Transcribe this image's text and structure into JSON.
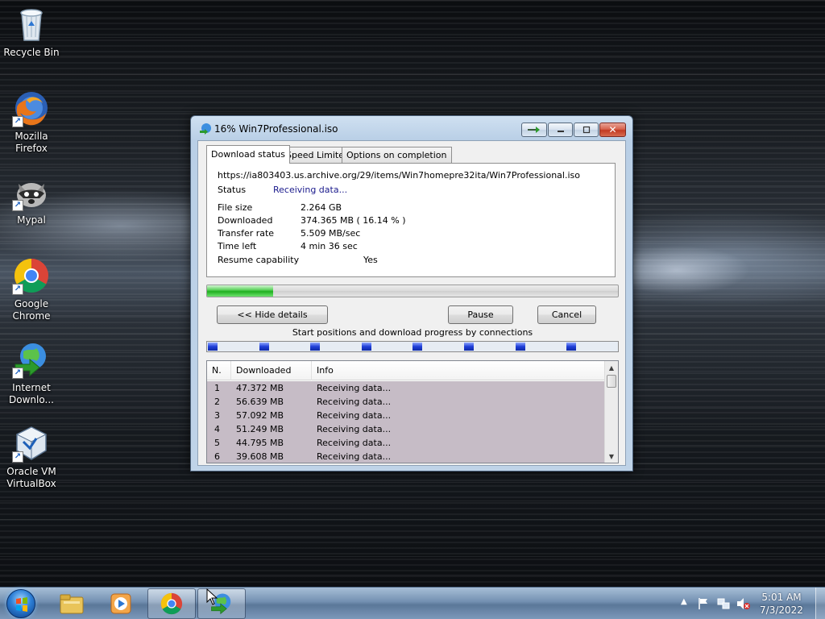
{
  "desktop": {
    "icons": [
      {
        "label": "Recycle Bin",
        "icon": "recycle-bin-icon"
      },
      {
        "label": "Mozilla Firefox",
        "icon": "firefox-icon"
      },
      {
        "label": "Mypal",
        "icon": "mypal-icon"
      },
      {
        "label": "Google Chrome",
        "icon": "chrome-icon"
      },
      {
        "label": "Internet Downlo...",
        "icon": "internet-download-manager-icon"
      },
      {
        "label": "Oracle VM VirtualBox",
        "icon": "virtualbox-icon"
      }
    ]
  },
  "window": {
    "title": "16% Win7Professional.iso",
    "tabs": [
      {
        "label": "Download status",
        "active": true
      },
      {
        "label": "Speed Limiter",
        "active": false
      },
      {
        "label": "Options on completion",
        "active": false
      }
    ],
    "status_panel": {
      "url": "https://ia803403.us.archive.org/29/items/Win7homepre32ita/Win7Professional.iso",
      "status_label": "Status",
      "status_value": "Receiving data...",
      "file_size_label": "File size",
      "file_size_value": "2.264  GB",
      "downloaded_label": "Downloaded",
      "downloaded_value": "374.365  MB  ( 16.14 % )",
      "transfer_rate_label": "Transfer rate",
      "transfer_rate_value": "5.509  MB/sec",
      "time_left_label": "Time left",
      "time_left_value": "4 min 36 sec",
      "resume_label": "Resume capability",
      "resume_value": "Yes"
    },
    "progress_fraction": 0.1614,
    "buttons": {
      "hide_details": "<< Hide details",
      "pause": "Pause",
      "cancel": "Cancel"
    },
    "connections_caption": "Start positions and download progress by connections",
    "connection_count": 8,
    "table": {
      "headers": [
        "N.",
        "Downloaded",
        "Info"
      ],
      "rows": [
        {
          "n": "1",
          "downloaded": "47.372  MB",
          "info": "Receiving data..."
        },
        {
          "n": "2",
          "downloaded": "56.639  MB",
          "info": "Receiving data..."
        },
        {
          "n": "3",
          "downloaded": "57.092  MB",
          "info": "Receiving data..."
        },
        {
          "n": "4",
          "downloaded": "51.249  MB",
          "info": "Receiving data..."
        },
        {
          "n": "5",
          "downloaded": "44.795  MB",
          "info": "Receiving data..."
        },
        {
          "n": "6",
          "downloaded": "39.608  MB",
          "info": "Receiving data..."
        }
      ]
    }
  },
  "taskbar": {
    "start": "start-button",
    "items": [
      {
        "icon": "file-explorer-icon",
        "open": false
      },
      {
        "icon": "media-player-icon",
        "open": false
      },
      {
        "icon": "chrome-icon",
        "open": true
      },
      {
        "icon": "internet-download-manager-icon",
        "open": true
      }
    ],
    "clock_time": "5:01 AM",
    "clock_date": "7/3/2022"
  },
  "colors": {
    "status_blue": "#1a1a8c",
    "progress_green": "#1fb01f",
    "connection_blue": "#1f3fd8",
    "table_row_bg": "#c6bcc6"
  }
}
